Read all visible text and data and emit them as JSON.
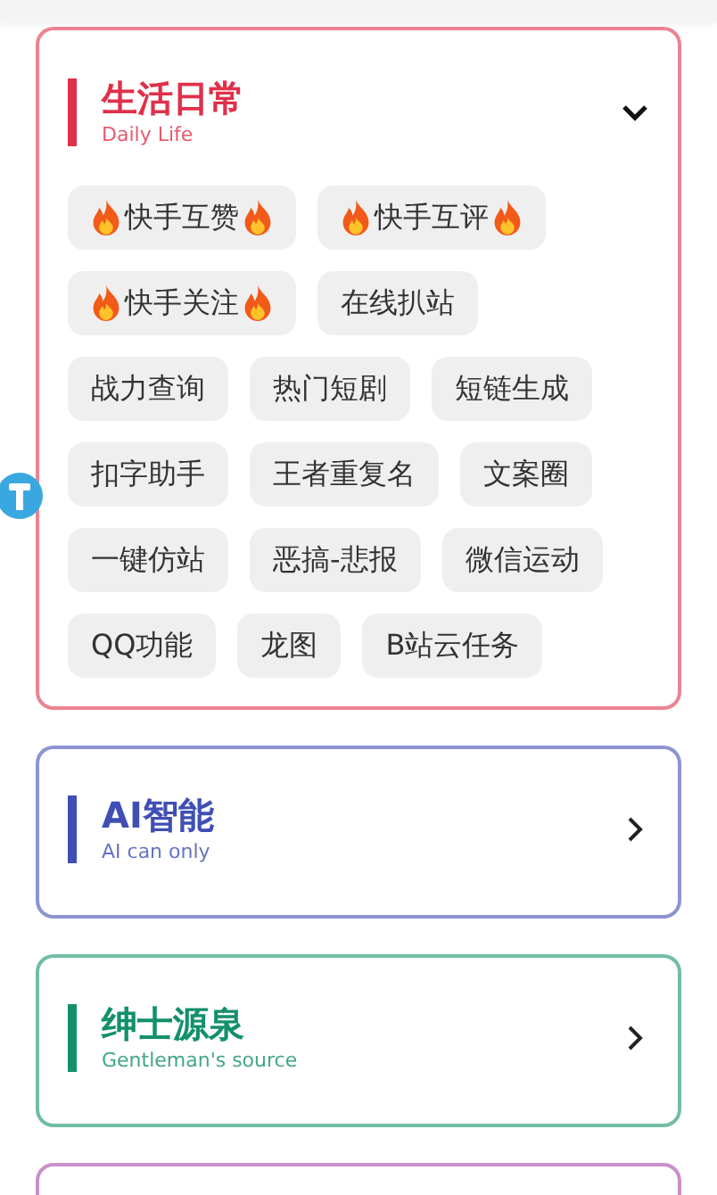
{
  "categories": [
    {
      "title": "生活日常",
      "subtitle": "Daily Life",
      "color": "#e0304a",
      "expanded": true,
      "items": [
        {
          "label": "快手互赞",
          "hot": true
        },
        {
          "label": "快手互评",
          "hot": true
        },
        {
          "label": "快手关注",
          "hot": true
        },
        {
          "label": "在线扒站",
          "hot": false
        },
        {
          "label": "战力查询",
          "hot": false
        },
        {
          "label": "热门短剧",
          "hot": false
        },
        {
          "label": "短链生成",
          "hot": false
        },
        {
          "label": "扣字助手",
          "hot": false
        },
        {
          "label": "王者重复名",
          "hot": false
        },
        {
          "label": "文案圈",
          "hot": false
        },
        {
          "label": "一键仿站",
          "hot": false
        },
        {
          "label": "恶搞-悲报",
          "hot": false
        },
        {
          "label": "微信运动",
          "hot": false
        },
        {
          "label": "QQ功能",
          "hot": false
        },
        {
          "label": "龙图",
          "hot": false
        },
        {
          "label": "B站云任务",
          "hot": false
        }
      ]
    },
    {
      "title": "AI智能",
      "subtitle": "AI can only",
      "color": "#3f4fb5",
      "expanded": false
    },
    {
      "title": "绅士源泉",
      "subtitle": "Gentleman's source",
      "color": "#13906a",
      "expanded": false
    },
    {
      "color": "#c890c8"
    }
  ]
}
